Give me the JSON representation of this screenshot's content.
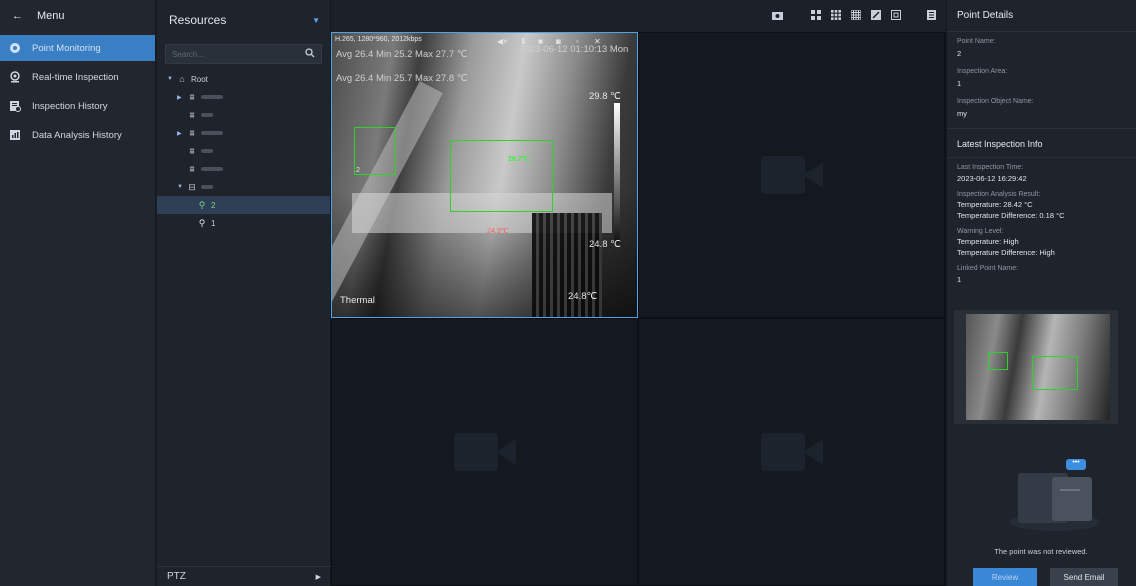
{
  "menu": {
    "back_icon": "arrow-left-icon",
    "title": "Menu",
    "items": [
      {
        "label": "Point Monitoring",
        "icon": "location-pin-icon",
        "active": true
      },
      {
        "label": "Real-time Inspection",
        "icon": "inspection-pin-icon",
        "active": false
      },
      {
        "label": "Inspection History",
        "icon": "history-doc-icon",
        "active": false
      },
      {
        "label": "Data Analysis History",
        "icon": "analysis-chart-icon",
        "active": false
      }
    ]
  },
  "resources": {
    "title": "Resources",
    "search_placeholder": "Search...",
    "tree": {
      "root": "Root",
      "point_selected": "2",
      "point_other": "1"
    },
    "ptz_label": "PTZ"
  },
  "video": {
    "codec_info": "H.265, 1280*960, 2012kbps",
    "timestamp": "2023-06-12 01:10:13 Mon",
    "stat_line_1": "Avg 26.4 Min 25.2 Max 27.7 ℃",
    "stat_line_2": "Avg 26.4 Min 25.7 Max 27.8 ℃",
    "temp_top": "29.8 ℃",
    "temp_mid": "24.8 ℃",
    "temp_bottom": "24.8℃",
    "point_temp": "26.7℃",
    "spot_temp": "24.3℃",
    "box_label": "2",
    "channel_label": "Thermal"
  },
  "details": {
    "title": "Point Details",
    "point_name_label": "Point Name:",
    "point_name": "2",
    "inspection_area_label": "Inspection Area:",
    "inspection_area": "1",
    "object_name_label": "Inspection Object Name:",
    "object_name": "my",
    "latest_title": "Latest Inspection Info",
    "last_time_label": "Last Inspection Time:",
    "last_time": "2023-06-12 16:29:42",
    "result_label": "Inspection Analysis Result:",
    "result_temp": "Temperature: 28.42 °C",
    "result_diff": "Temperature Difference: 0.18 °C",
    "warning_label": "Warning Level:",
    "warning_temp": "Temperature: High",
    "warning_diff": "Temperature Difference: High",
    "linked_label": "Linked Point Name:",
    "linked_name": "1",
    "not_reviewed": "The point was not reviewed.",
    "review_button": "Review",
    "email_button": "Send Email"
  },
  "colors": {
    "accent": "#3a7fc4",
    "detect_box": "#2ed22e"
  }
}
